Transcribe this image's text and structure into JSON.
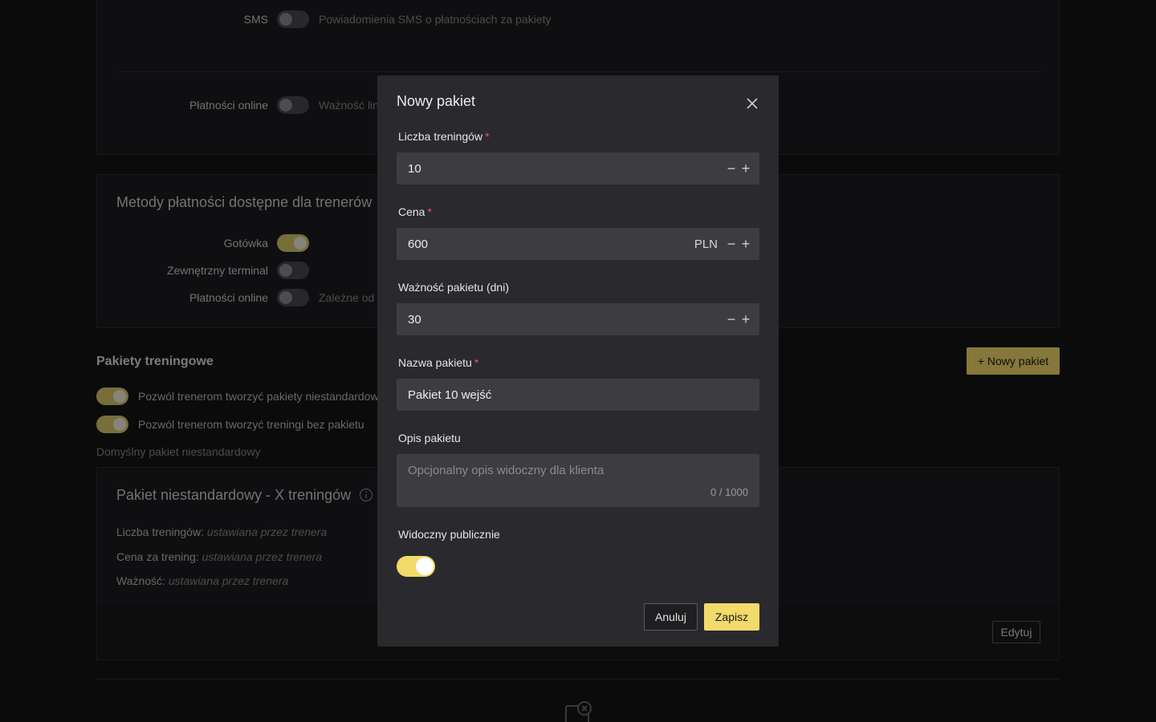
{
  "background": {
    "sms": {
      "label": "SMS",
      "desc": "Powiadomienia SMS o płatnościach za pakiety"
    },
    "online_payments_top": {
      "label": "Płatności online",
      "desc": "Ważność lin"
    },
    "methods": {
      "title": "Metody płatności dostępne dla trenerów",
      "cash": "Gotówka",
      "external_terminal": "Zewnętrzny terminal",
      "online": "Płatności online",
      "online_desc": "Zależne od"
    },
    "packages": {
      "title": "Pakiety treningowe",
      "new_button": "+ Nowy pakiet",
      "allow_custom": "Pozwól trenerom tworzyć pakiety niestandardow",
      "allow_no_package": "Pozwól trenerom tworzyć treningi bez pakietu",
      "default_custom": "Domyślny pakiet niestandardowy"
    },
    "custom_card": {
      "title": "Pakiet niestandardowy - X treningów",
      "count_label": "Liczba treningów:",
      "count_value": "ustawiana przez trenera",
      "price_label": "Cena za trening:",
      "price_value": "ustawiana przez trenera",
      "validity_label": "Ważność:",
      "validity_value": "ustawiana przez trenera",
      "edit_button": "Edytuj"
    }
  },
  "modal": {
    "title": "Nowy pakiet",
    "training_count": {
      "label": "Liczba treningów",
      "required": "*",
      "value": "10"
    },
    "price": {
      "label": "Cena",
      "required": "*",
      "value": "600",
      "currency": "PLN"
    },
    "validity": {
      "label": "Ważność pakietu (dni)",
      "value": "30"
    },
    "name": {
      "label": "Nazwa pakietu",
      "required": "*",
      "value": "Pakiet 10 wejść"
    },
    "description": {
      "label": "Opis pakietu",
      "placeholder": "Opcjonalny opis widoczny dla klienta",
      "counter": "0 / 1000"
    },
    "public": {
      "label": "Widoczny publicznie",
      "on": true
    },
    "cancel": "Anuluj",
    "save": "Zapisz"
  },
  "colors": {
    "accent": "#f2da6b",
    "required": "#e05a6a"
  }
}
